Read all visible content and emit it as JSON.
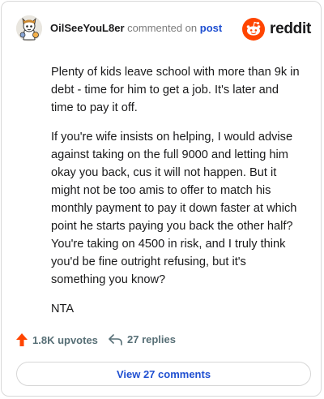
{
  "comment": {
    "username": "OilSeeYouL8er",
    "action_text": "commented on",
    "target_link": "post",
    "paragraphs": [
      "Plenty of kids leave school with more than 9k in debt - time for him to get a job. It's later and time to pay it off.",
      "If you're wife insists on helping, I would advise against taking on the full 9000 and letting him okay you back, cus it will not happen. But it might not be too amis to offer to match his monthly payment to pay it down faster at which point he starts paying you back the other half? You're taking on 4500 in risk, and I truly think you'd be fine outright refusing, but it's something you know?",
      "NTA"
    ]
  },
  "brand": {
    "name": "reddit",
    "color": "#ff4500"
  },
  "footer": {
    "upvotes_label": "1.8K upvotes",
    "replies_label": "27 replies",
    "view_button_label": "View 27 comments"
  },
  "icons": {
    "avatar": "cartoon-avatar-icon",
    "logo": "reddit-snoo-icon",
    "upvote": "upvote-arrow-icon",
    "reply": "reply-arrow-icon"
  },
  "colors": {
    "upvote": "#ff4500",
    "link": "#1f4fd1",
    "muted": "#576f76"
  }
}
